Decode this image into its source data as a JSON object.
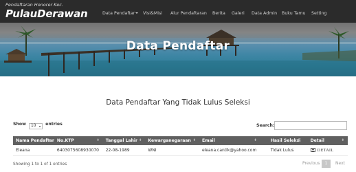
{
  "brand": {
    "subtitle": "Pendaftaran Honorer Kec.",
    "title": "PulauDerawan"
  },
  "nav": [
    {
      "label": "Data Pendaftar",
      "dropdown": true
    },
    {
      "label": "Visi&Misi"
    },
    {
      "label": "Alur Pendaftaran"
    },
    {
      "label": "Berita"
    },
    {
      "label": "Galeri"
    },
    {
      "label": "Data Admin"
    },
    {
      "label": "Buku Tamu"
    },
    {
      "label": "Setting"
    }
  ],
  "hero": {
    "title": "Data Pendaftar"
  },
  "section": {
    "title": "Data Pendaftar Yang Tidak Lulus Seleksi"
  },
  "table_controls": {
    "show_label": "Show",
    "entries_value": "10",
    "entries_label": "entries",
    "search_label": "Search:"
  },
  "table": {
    "columns": [
      "Nama Pendaftar",
      "No.KTP",
      "Tanggal Lahir",
      "Kewarganegaraan",
      "Email",
      "Hasil Seleksi",
      "Detail"
    ],
    "rows": [
      {
        "nama": "Eleana",
        "ktp": "6403075608930070",
        "tanggal_lahir": "22-08-1989",
        "kewarganegaraan": "WNI",
        "email": "eleana.cantik@yahoo.com",
        "hasil": "Tidak Lulus",
        "detail": "DETAIL"
      }
    ]
  },
  "pagination": {
    "info": "Showing 1 to 1 of 1 entries",
    "previous": "Previous",
    "current": "1",
    "next": "Next"
  },
  "colors": {
    "navbar": "#2b2b2b",
    "table_header": "#606060",
    "page_bg": "#ffffff"
  }
}
